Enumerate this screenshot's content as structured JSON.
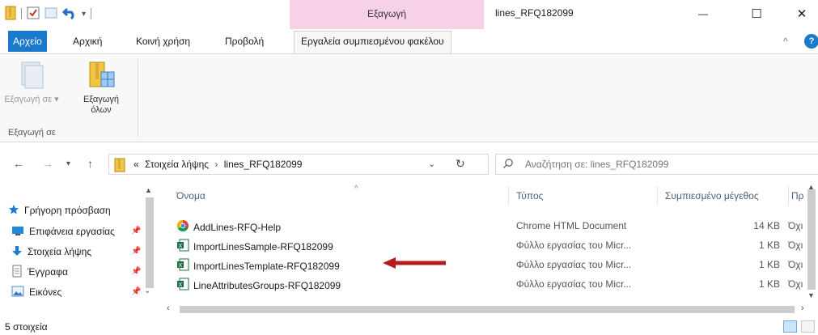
{
  "titlebar": {
    "context_tab_header": "Εξαγωγή",
    "window_title": "lines_RFQ182099",
    "minimize": "—",
    "maximize": "☐",
    "close": "✕"
  },
  "ribbon_tabs": {
    "file": "Αρχείο",
    "home": "Αρχική",
    "share": "Κοινή χρήση",
    "view": "Προβολή",
    "compressed_tools": "Εργαλεία συμπιεσμένου φακέλου",
    "collapse": "^",
    "help": "?"
  },
  "ribbon": {
    "extract_to": "Εξαγωγή σε ▾",
    "extract_all_line1": "Εξαγωγή",
    "extract_all_line2": "όλων",
    "group_label": "Εξαγωγή σε"
  },
  "address": {
    "overflow": "«",
    "crumb1": "Στοιχεία λήψης",
    "separator": "›",
    "crumb2": "lines_RFQ182099",
    "search_placeholder": "Αναζήτηση σε: lines_RFQ182099"
  },
  "nav_pane": {
    "items": [
      {
        "label": "Γρήγορη πρόσβαση",
        "icon": "star-icon"
      },
      {
        "label": "Επιφάνεια εργασίας",
        "icon": "desktop-icon"
      },
      {
        "label": "Στοιχεία λήψης",
        "icon": "download-icon"
      },
      {
        "label": "Έγγραφα",
        "icon": "documents-icon"
      },
      {
        "label": "Εικόνες",
        "icon": "pictures-icon"
      }
    ]
  },
  "file_list": {
    "columns": {
      "name": "Όνομα",
      "type": "Τύπος",
      "size": "Συμπιεσμένο μέγεθος",
      "more": "Πρ"
    },
    "rows": [
      {
        "name": "AddLines-RFQ-Help",
        "type": "Chrome HTML Document",
        "size": "14 KB",
        "more": "Όχι",
        "icon": "chrome-icon"
      },
      {
        "name": "ImportLinesSample-RFQ182099",
        "type": "Φύλλο εργασίας του Micr...",
        "size": "1 KB",
        "more": "Όχι",
        "icon": "excel-icon"
      },
      {
        "name": "ImportLinesTemplate-RFQ182099",
        "type": "Φύλλο εργασίας του Micr...",
        "size": "1 KB",
        "more": "Όχι",
        "icon": "excel-icon"
      },
      {
        "name": "LineAttributesGroups-RFQ182099",
        "type": "Φύλλο εργασίας του Micr...",
        "size": "1 KB",
        "more": "Όχι",
        "icon": "excel-icon"
      }
    ]
  },
  "status": {
    "item_count": "5 στοιχεία"
  },
  "colors": {
    "accent": "#1979ca",
    "context_tab": "#f7d2e6",
    "arrow": "#b71c1c"
  }
}
